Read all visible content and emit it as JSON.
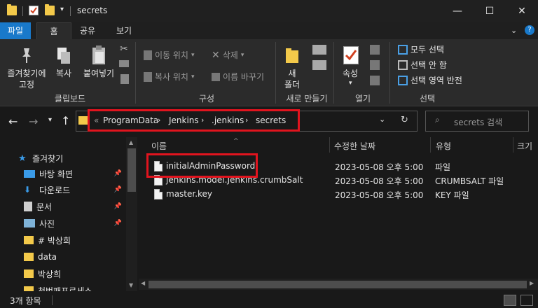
{
  "window": {
    "title": "secrets",
    "minimize": "—",
    "maximize": "☐",
    "close": "✕"
  },
  "ribbon_tabs": [
    "파일",
    "홈",
    "공유",
    "보기"
  ],
  "ribbon": {
    "pin_label": "즐겨찾기에\n고정",
    "copy_label": "복사",
    "paste_label": "붙여넣기",
    "clipboard_group": "클립보드",
    "move_to": "이동 위치",
    "copy_to": "복사 위치",
    "delete": "삭제",
    "rename": "이름 바꾸기",
    "organize_group": "구성",
    "new_folder": "새\n폴더",
    "new_group": "새로 만들기",
    "properties": "속성",
    "open_group": "열기",
    "select_all": "모두 선택",
    "select_none": "선택 안 함",
    "invert_selection": "선택 영역 반전",
    "select_group": "선택"
  },
  "address": {
    "overflow": "«",
    "crumbs": [
      "ProgramData",
      "Jenkins",
      ".jenkins",
      "secrets"
    ],
    "search_placeholder": "secrets 검색"
  },
  "nav": {
    "items": [
      {
        "label": "즐겨찾기",
        "icon": "star-icon",
        "pinned": false
      },
      {
        "label": "바탕 화면",
        "icon": "desktop-icon",
        "pinned": true
      },
      {
        "label": "다운로드",
        "icon": "download-icon",
        "pinned": true
      },
      {
        "label": "문서",
        "icon": "document-icon",
        "pinned": true
      },
      {
        "label": "사진",
        "icon": "picture-icon",
        "pinned": true
      },
      {
        "label": "# 박상희",
        "icon": "folder-icon",
        "pinned": false
      },
      {
        "label": "data",
        "icon": "folder-icon",
        "pinned": false
      },
      {
        "label": "박상희",
        "icon": "folder-icon",
        "pinned": false
      },
      {
        "label": "천번패프로세스",
        "icon": "folder-icon",
        "pinned": false
      }
    ]
  },
  "columns": [
    "이름",
    "수정한 날짜",
    "유형",
    "크기"
  ],
  "files": [
    {
      "name": "initialAdminPassword",
      "modified": "2023-05-08 오후 5:00",
      "type": "파일"
    },
    {
      "name": "jenkins.model.Jenkins.crumbSalt",
      "modified": "2023-05-08 오후 5:00",
      "type": "CRUMBSALT 파일"
    },
    {
      "name": "master.key",
      "modified": "2023-05-08 오후 5:00",
      "type": "KEY 파일"
    }
  ],
  "status": {
    "item_count": "3개 항목"
  },
  "colors": {
    "accent": "#1979ca",
    "highlight": "#e1141e",
    "folder": "#f3c94a"
  }
}
